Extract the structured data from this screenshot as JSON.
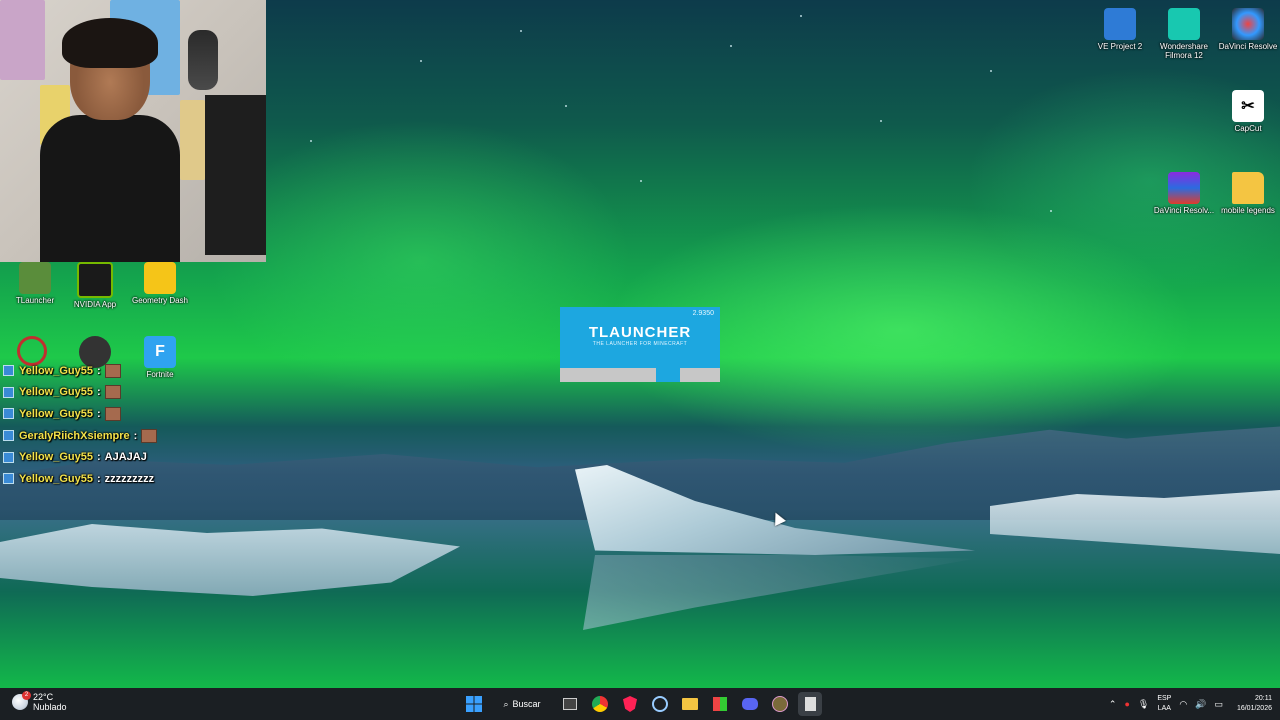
{
  "desktop": {
    "wallpaper": "aurora-iceberg",
    "icons": [
      {
        "id": "tlauncher",
        "label": "TLauncher",
        "icon": "tlauncher-icon",
        "color": "#5a8d3b"
      },
      {
        "id": "nvidia",
        "label": "NVIDIA App",
        "icon": "nvidia-icon",
        "color": "#76b900"
      },
      {
        "id": "geometry-dash",
        "label": "Geometry Dash",
        "icon": "geometry-dash-icon",
        "color": "#f5c518"
      },
      {
        "id": "fortnite",
        "label": "Fortnite",
        "icon": "fortnite-icon",
        "color": "#2fa3f0",
        "glyph": "F"
      },
      {
        "id": "ve-project",
        "label": "VE Project 2",
        "icon": "video-project-icon",
        "color": "#2e7bd6"
      },
      {
        "id": "filmora",
        "label": "Wondershare Filmora 12",
        "icon": "filmora-icon",
        "color": "#18c8b0"
      },
      {
        "id": "davinci-resolve",
        "label": "DaVinci Resolve",
        "icon": "davinci-resolve-icon",
        "color": "#2a2a2a"
      },
      {
        "id": "capcut",
        "label": "CapCut",
        "icon": "capcut-icon",
        "color": "#ffffff"
      },
      {
        "id": "davinci-resolve-rar",
        "label": "DaVinci Resolv...",
        "icon": "winrar-icon",
        "color": "#8b2be0"
      },
      {
        "id": "mobile-legends",
        "label": "mobile legends",
        "icon": "folder-icon",
        "color": "#f4c542"
      }
    ]
  },
  "tlauncher": {
    "title": "TLAUNCHER",
    "subtitle": "THE LAUNCHER FOR MINECRAFT",
    "version": "2.9350",
    "progress": 0.6,
    "accent": "#1da7e0"
  },
  "chat": [
    {
      "name": "Yellow_Guy55",
      "sep": ":",
      "message": "",
      "emote": true
    },
    {
      "name": "Yellow_Guy55",
      "sep": ":",
      "message": "",
      "emote": true
    },
    {
      "name": "Yellow_Guy55",
      "sep": ":",
      "message": "",
      "emote": true
    },
    {
      "name": "GeralyRiichXsiempre",
      "sep": ":",
      "message": "",
      "emote": true
    },
    {
      "name": "Yellow_Guy55",
      "sep": ":",
      "message": "AJAJAJ",
      "emote": false
    },
    {
      "name": "Yellow_Guy55",
      "sep": ":",
      "message": "zzzzzzzzz",
      "emote": false
    }
  ],
  "taskbar": {
    "weather": {
      "temp": "22°C",
      "condition": "Nublado"
    },
    "search_label": "Buscar",
    "apps": [
      "windows-start-icon",
      "task-view-icon",
      "chrome-icon",
      "brave-icon",
      "steam-icon",
      "file-explorer-icon",
      "store-icon",
      "discord-icon",
      "minecraft-icon",
      "notepad-icon"
    ],
    "lang_line1": "ESP",
    "lang_line2": "LAA",
    "time": "20:11",
    "date": "16/01/2026"
  }
}
